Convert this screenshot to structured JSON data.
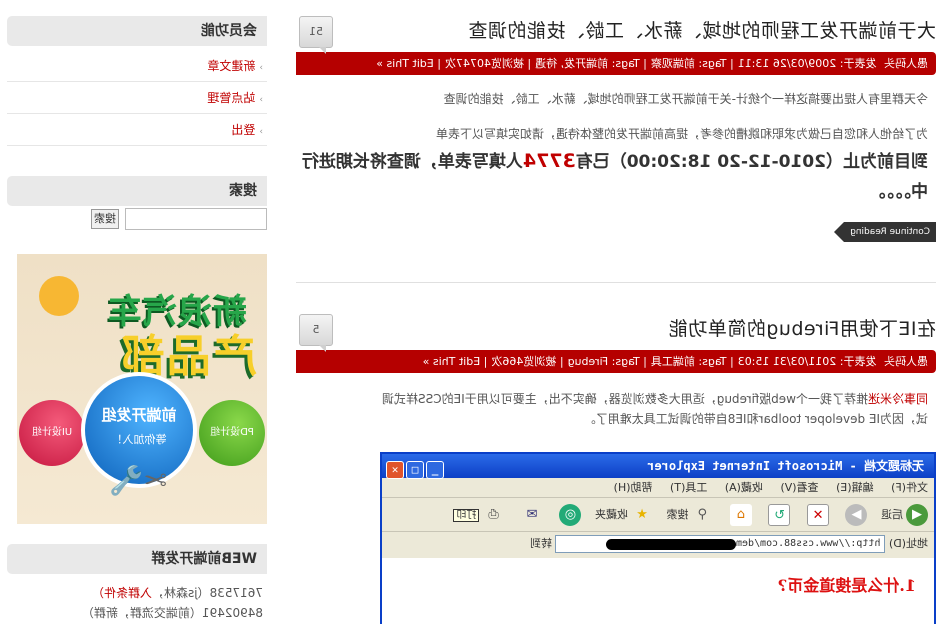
{
  "posts": [
    {
      "title": "大于前端开发工程师的地域、薪水、工龄、技能的调查",
      "comments": "51",
      "meta": {
        "author": "愚人码头",
        "posted": "发表于: 2009/03/26 13:11",
        "tags": "Tags: 前端观察",
        "tag_extra": "Tags: 前端开发, 待遇",
        "views": "被浏览40747次",
        "edit": "Edit This »"
      },
      "intro": "今天群里有人提出要搞这样一个统计-关于前端开发工程师的地域、薪水、工龄、技能的调查",
      "para": "为了给他人和您自己做为求职和跳槽的参考，提高前端开发的整体待遇，请如实填写以下表单",
      "highlight_prefix": "到目前为止（2010-12-20 18:20:00）已有",
      "highlight_num": "3774",
      "highlight_suffix": "人填写表单，调查将长期进行中。。。。",
      "continue": "Continue Reading"
    },
    {
      "title": "在IE下使用Firebug的简单功能",
      "comments": "5",
      "meta": {
        "author": "愚人码头",
        "posted": "发表于: 2011/03/31 15:03",
        "tags": "Tags: 前端工具",
        "tag_extra": "Tags: Firebug",
        "views": "被浏览466次",
        "edit": "Edit This »"
      },
      "para_author": "同事冷米迷",
      "para_line1": "推荐了我一个web版firebug，适用大多数浏览器，确实不出，主要可以用于IE的CSS样式调",
      "para_line2": "试，因为IE developer toolbar和IE8自带的调试工具太难用了。"
    }
  ],
  "ie": {
    "title": "无标题文档 - Microsoft Internet Explorer",
    "menu": [
      "文件(F)",
      "编辑(E)",
      "查看(V)",
      "收藏(A)",
      "工具(T)",
      "帮助(H)"
    ],
    "toolbar": [
      "后退",
      "搜索",
      "收藏夹"
    ],
    "tooltip": "打印",
    "address_label": "地址(D)",
    "address": "http://www.css88.com/dem",
    "go_label": "转到",
    "heading": "1.什么是搜道金币?"
  },
  "sidebar": {
    "member_title": "会员功能",
    "member_items": [
      "新建文章",
      "站点管理",
      "登出"
    ],
    "search_title": "搜索",
    "search_button": "搜索",
    "ad": {
      "line1": "新浪汽车",
      "line2": "产品部",
      "circle_main": "前端开发组",
      "circle_sub": "等你加入！",
      "left_circle": "PD设计组",
      "right_circle": "UI设计组"
    },
    "web_title": "WEB前端开发群",
    "group1_num": "7617538",
    "group1_name": "（js森林，",
    "group1_status": "入群条件）",
    "group2_num": "84902491",
    "group2_name": "（前端交流群，新群）"
  }
}
